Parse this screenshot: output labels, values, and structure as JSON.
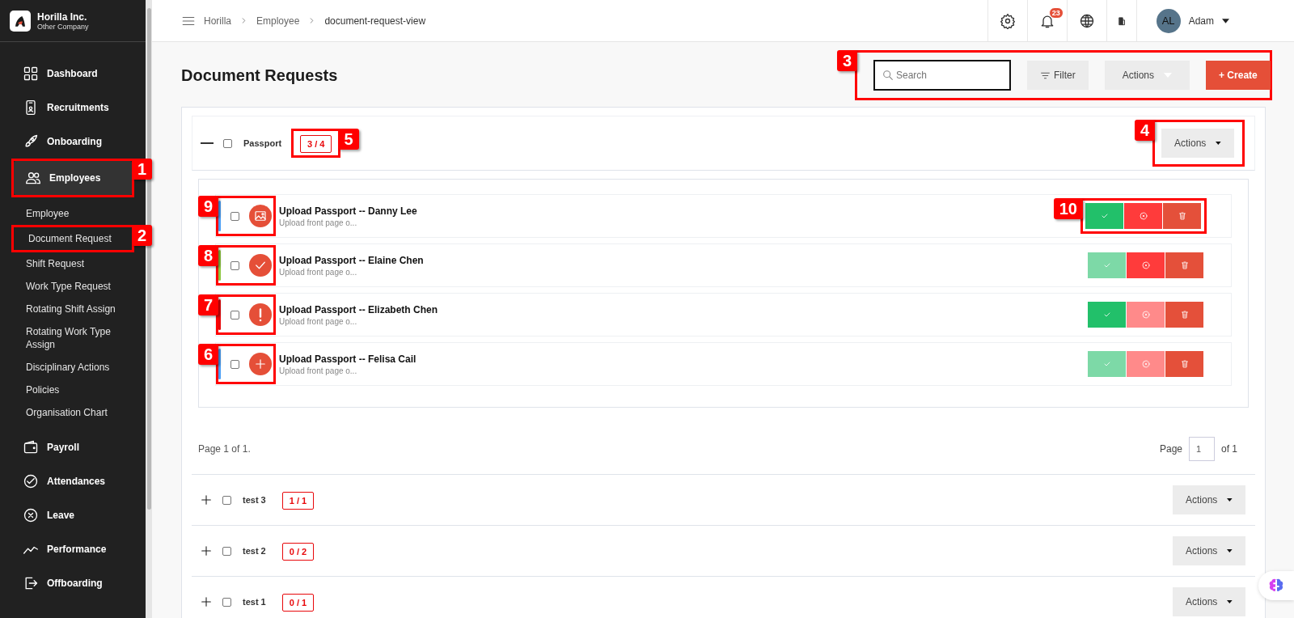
{
  "company": {
    "name": "Horilla Inc.",
    "subtitle": "Other Company"
  },
  "sidebar": {
    "items": [
      {
        "label": "Dashboard",
        "selected": false
      },
      {
        "label": "Recruitments",
        "selected": false
      },
      {
        "label": "Onboarding",
        "selected": false
      },
      {
        "label": "Employees",
        "selected": true,
        "annotation": "1",
        "children": [
          {
            "label": "Employee"
          },
          {
            "label": "Document Request",
            "annotation": "2"
          },
          {
            "label": "Shift Request"
          },
          {
            "label": "Work Type Request"
          },
          {
            "label": "Rotating Shift Assign"
          },
          {
            "label": "Rotating Work Type Assign"
          },
          {
            "label": "Disciplinary Actions"
          },
          {
            "label": "Policies"
          },
          {
            "label": "Organisation Chart"
          }
        ]
      },
      {
        "label": "Payroll",
        "selected": false
      },
      {
        "label": "Attendances",
        "selected": false
      },
      {
        "label": "Leave",
        "selected": false
      },
      {
        "label": "Performance",
        "selected": false
      },
      {
        "label": "Offboarding",
        "selected": false
      }
    ]
  },
  "breadcrumb": [
    "Horilla",
    "Employee",
    "document-request-view"
  ],
  "topbar": {
    "notification_count": "23",
    "user": {
      "initials": "AL",
      "name": "Adam"
    }
  },
  "page_title": "Document Requests",
  "toolbar": {
    "annotation": "3",
    "search": {
      "placeholder": "Search"
    },
    "filter": "Filter",
    "actions": "Actions",
    "create": "+ Create"
  },
  "groups": [
    {
      "title": "Passport",
      "count": "3 / 4",
      "expanded": true,
      "checked": false,
      "count_annotation": "5",
      "actions": "Actions",
      "actions_annotation": "4",
      "requests": [
        {
          "title": "Upload Passport -- Danny Lee",
          "subtitle": "Upload front page o...",
          "kind": "uploaded",
          "color": "#4a9ff5",
          "checked": false,
          "annotation": "9",
          "approve_disabled": false,
          "reject_disabled": false,
          "actions_annotation": "10"
        },
        {
          "title": "Upload Passport -- Elaine Chen",
          "subtitle": "Upload front page o...",
          "kind": "approved",
          "color": "#8cc63f",
          "checked": false,
          "annotation": "8",
          "approve_disabled": true,
          "reject_disabled": false
        },
        {
          "title": "Upload Passport -- Elizabeth Chen",
          "subtitle": "Upload front page o...",
          "kind": "rejected",
          "color": "#e8080b",
          "checked": false,
          "annotation": "7",
          "approve_disabled": false,
          "reject_disabled": true
        },
        {
          "title": "Upload Passport -- Felisa Cail",
          "subtitle": "Upload front page o...",
          "kind": "requested",
          "color": "#4a9ff5",
          "checked": false,
          "annotation": "6",
          "approve_disabled": true,
          "reject_disabled": true
        }
      ],
      "pagination": {
        "summary": "Page 1 of 1.",
        "label": "Page",
        "value": "1",
        "total": "of 1"
      }
    },
    {
      "title": "test 3",
      "count": "1 / 1",
      "expanded": false,
      "checked": false,
      "actions": "Actions"
    },
    {
      "title": "test 2",
      "count": "0 / 2",
      "expanded": false,
      "checked": false,
      "actions": "Actions"
    },
    {
      "title": "test 1",
      "count": "0 / 1",
      "expanded": false,
      "checked": false,
      "actions": "Actions"
    }
  ]
}
